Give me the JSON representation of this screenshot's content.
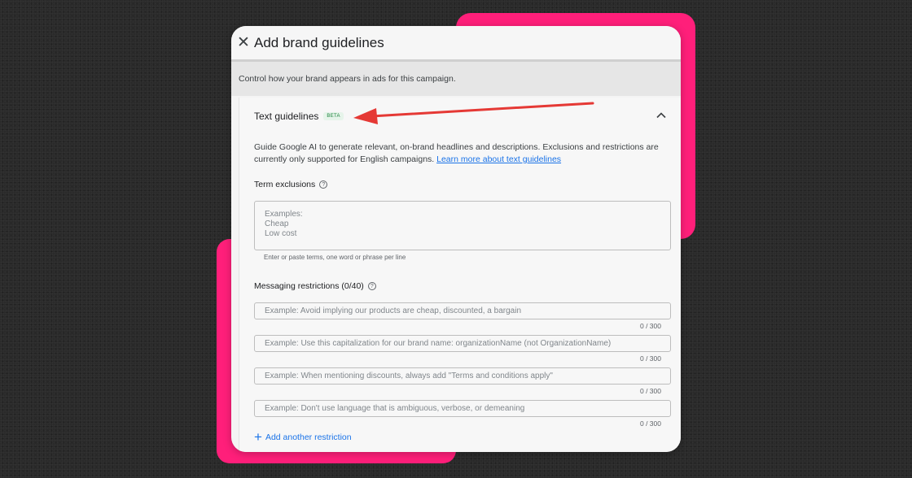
{
  "dialog": {
    "title": "Add brand guidelines",
    "intro": "Control how your brand appears in ads for this campaign."
  },
  "text_guidelines": {
    "title": "Text guidelines",
    "badge": "BETA",
    "description": "Guide Google AI to generate relevant, on-brand headlines and descriptions. Exclusions and restrictions are currently only supported for English campaigns.",
    "learn_more": "Learn more about text guidelines"
  },
  "term_exclusions": {
    "label": "Term exclusions",
    "placeholder": "Examples:\nCheap\nLow cost",
    "helper": "Enter or paste terms, one word or phrase per line"
  },
  "messaging_restrictions": {
    "label": "Messaging restrictions (0/40)",
    "items": [
      {
        "placeholder": "Example: Avoid implying our products are cheap, discounted, a bargain",
        "counter": "0 / 300"
      },
      {
        "placeholder": "Example: Use this capitalization for our brand name: organizationName (not OrganizationName)",
        "counter": "0 / 300"
      },
      {
        "placeholder": "Example: When mentioning discounts, always add \"Terms and conditions apply\"",
        "counter": "0 / 300"
      },
      {
        "placeholder": "Example: Don't use language that is ambiguous, verbose, or demeaning",
        "counter": "0 / 300"
      }
    ],
    "add_label": "Add another restriction"
  },
  "colors": {
    "accent_pink": "#ff1f7a",
    "arrow_red": "#e53935",
    "link_blue": "#1a73e8"
  }
}
